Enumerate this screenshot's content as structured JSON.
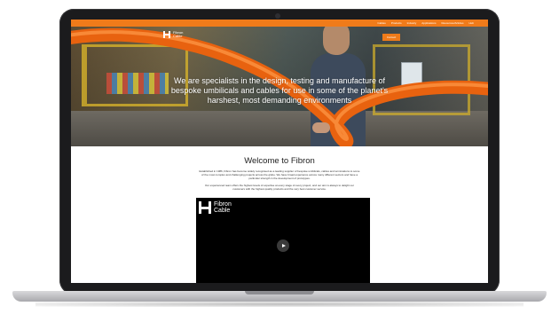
{
  "topbar": {
    "nav": [
      "Cables",
      "Products",
      "Industry",
      "Applications",
      "Resources/Articles",
      "Hub"
    ]
  },
  "brand": {
    "name_line1": "Fibron",
    "name_line2": "Cable",
    "accent": "#f07b1a"
  },
  "hero": {
    "contact_label": "Contact",
    "headline": "We are specialists in the design, testing and manufacture of bespoke umbilicals and cables for use in some of the planet's harshest, most demanding environments"
  },
  "welcome": {
    "title": "Welcome to Fibron",
    "paragraph1": "Established in 1986, Fibron has become widely recognised as a leading supplier of bespoke umbilicals, cables and terminations to some of the most complex and challenging projects across the globe. We have broad experience across many different sectors and have a particular strength in the development of prototypes.",
    "paragraph2": "Our experienced team offers the highest levels of expertise at every stage of every project, and our aim is always to delight our customers with the highest quality products and the very best customer service."
  },
  "video": {
    "logo_line1": "Fibron",
    "logo_line2": "Cable",
    "play_icon": "play-icon"
  }
}
